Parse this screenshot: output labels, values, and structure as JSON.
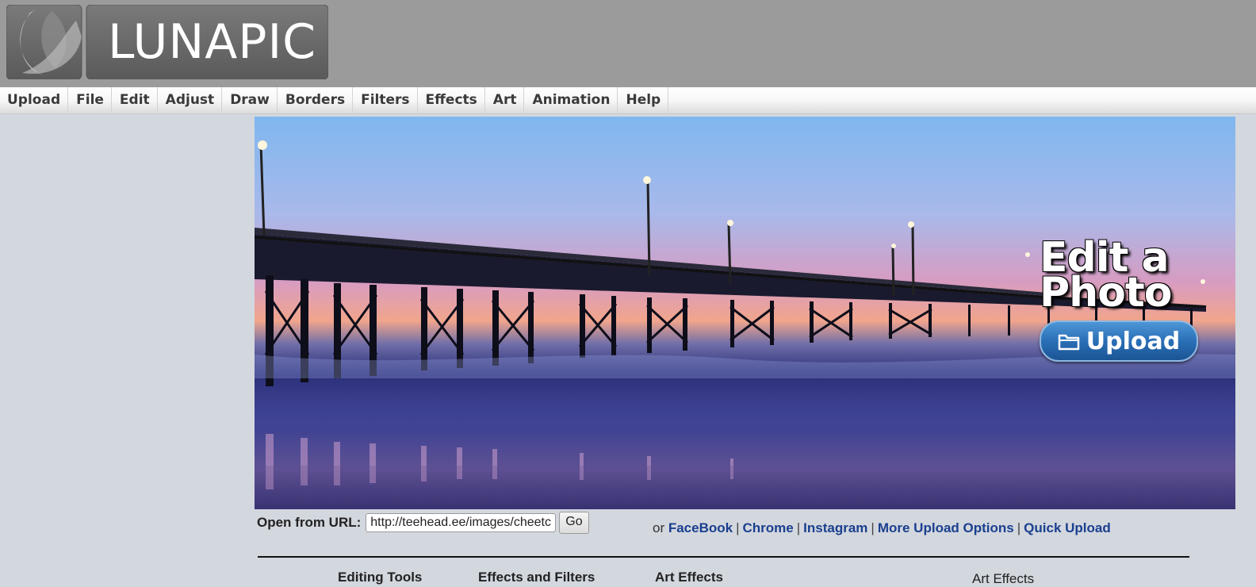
{
  "logo": {
    "text": "LUNAPIC"
  },
  "menu": {
    "items": [
      "Upload",
      "File",
      "Edit",
      "Adjust",
      "Draw",
      "Borders",
      "Filters",
      "Effects",
      "Art",
      "Animation",
      "Help"
    ]
  },
  "hero": {
    "title_line1": "Edit a",
    "title_line2": "Photo",
    "upload_label": "Upload"
  },
  "url_row": {
    "label": "Open from URL:",
    "value": "http://teehead.ee/images/cheetc",
    "go_label": "Go"
  },
  "links": {
    "prefix": "or",
    "items": [
      "FaceBook",
      "Chrome",
      "Instagram",
      "More Upload Options",
      "Quick Upload"
    ],
    "separator": "|"
  },
  "footer_partial": {
    "col1": "Editing Tools",
    "col2": "Effects and Filters",
    "col3": "Art Effects",
    "col4": "Art Effects"
  },
  "colors": {
    "header_bg": "#9b9b9b",
    "page_bg": "#d3d7de",
    "link": "#1a3f8f",
    "upload_button": "#2a6fb7"
  }
}
